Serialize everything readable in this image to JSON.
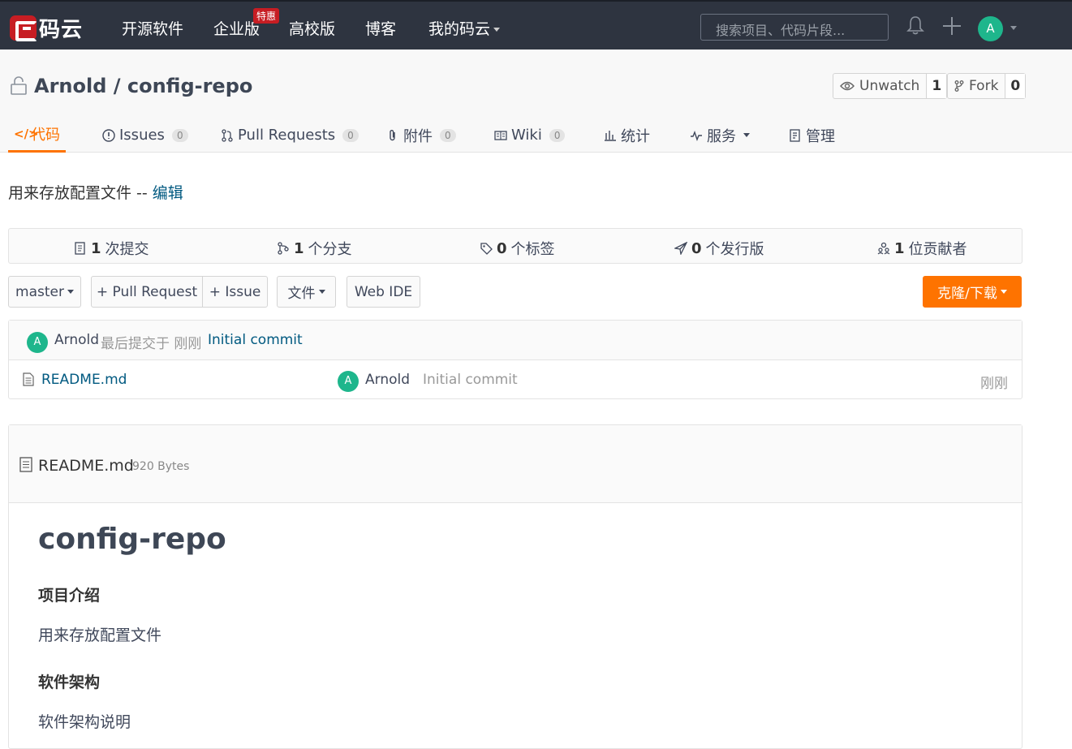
{
  "nav": {
    "logo_text": "码云",
    "items": [
      "开源软件",
      "企业版",
      "高校版",
      "博客",
      "我的码云"
    ],
    "badge": "特惠",
    "search_placeholder": "搜索项目、代码片段..."
  },
  "user": {
    "avatar_letter": "A"
  },
  "repo": {
    "title": "Arnold / config-repo",
    "unwatch_label": "Unwatch",
    "unwatch_count": "1",
    "fork_label": "Fork",
    "fork_count": "0"
  },
  "tabs": [
    {
      "label": "代码",
      "count": null,
      "active": true,
      "icon": "code-icon"
    },
    {
      "label": "Issues",
      "count": "0",
      "icon": "issue-icon"
    },
    {
      "label": "Pull Requests",
      "count": "0",
      "icon": "pull-request-icon"
    },
    {
      "label": "附件",
      "count": "0",
      "icon": "attachment-icon"
    },
    {
      "label": "Wiki",
      "count": "0",
      "icon": "wiki-icon"
    },
    {
      "label": "统计",
      "count": null,
      "icon": "stats-icon"
    },
    {
      "label": "服务",
      "count": null,
      "icon": "service-icon"
    },
    {
      "label": "管理",
      "count": null,
      "icon": "manage-icon"
    }
  ],
  "description": {
    "text": "用来存放配置文件 -- ",
    "edit_link": "编辑"
  },
  "stats": [
    {
      "num": "1",
      "label": "次提交",
      "icon": "commit-icon"
    },
    {
      "num": "1",
      "label": "个分支",
      "icon": "branch-icon"
    },
    {
      "num": "0",
      "label": "个标签",
      "icon": "tag-icon"
    },
    {
      "num": "0",
      "label": "个发行版",
      "icon": "release-icon"
    },
    {
      "num": "1",
      "label": "位贡献者",
      "icon": "contributors-icon"
    }
  ],
  "actions": {
    "branch": "master",
    "pull_request": "+ Pull Request",
    "issue": "+ Issue",
    "file": "文件",
    "web_ide": "Web IDE",
    "clone": "克隆/下载"
  },
  "last_commit": {
    "author": "Arnold",
    "text": "最后提交于 刚刚",
    "message": "Initial commit"
  },
  "files": [
    {
      "name": "README.md",
      "author": "Arnold",
      "message": "Initial commit",
      "time": "刚刚"
    }
  ],
  "readme": {
    "filename": "README.md",
    "size": "920 Bytes",
    "h1": "config-repo",
    "section1_title": "项目介绍",
    "section1_text": "用来存放配置文件",
    "section2_title": "软件架构",
    "section2_text": "软件架构说明"
  },
  "colors": {
    "accent": "#fe7300",
    "nav_bg": "#2e3440",
    "brand_red": "#c71d23",
    "avatar": "#1eb68c",
    "link": "#005980"
  }
}
